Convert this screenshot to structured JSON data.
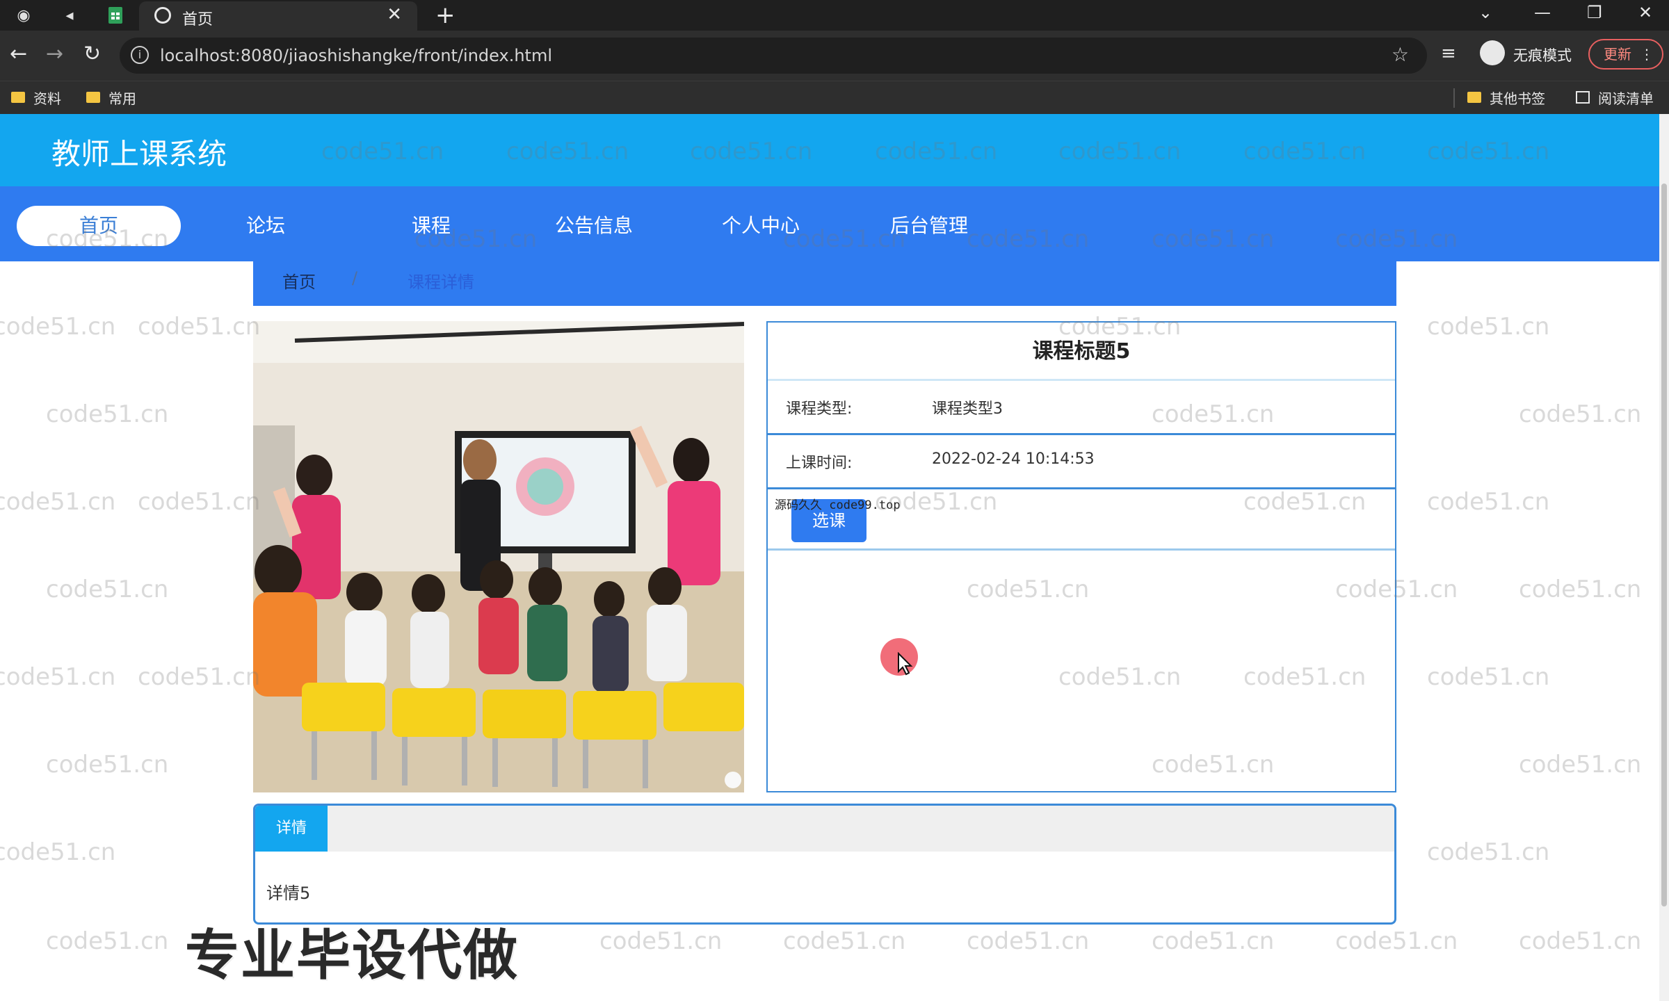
{
  "browser": {
    "tab_title": "首页",
    "url": "localhost:8080/jiaoshishangke/front/index.html",
    "incognito_label": "无痕模式",
    "update_label": "更新",
    "bookmarks": [
      {
        "label": "资料"
      },
      {
        "label": "常用"
      }
    ],
    "other_bookmarks": "其他书签",
    "reading_list": "阅读清单"
  },
  "site": {
    "title": "教师上课系统",
    "nav": [
      "首页",
      "论坛",
      "课程",
      "公告信息",
      "个人中心",
      "后台管理"
    ],
    "active_nav": "首页"
  },
  "breadcrumb": {
    "home": "首页",
    "separator": "/",
    "current": "课程详情"
  },
  "course": {
    "title": "课程标题5",
    "type_label": "课程类型:",
    "type_value": "课程类型3",
    "time_label": "上课时间:",
    "time_value": "2022-02-24 10:14:53",
    "select_button": "选课",
    "source_note": "源码久久 code99.top"
  },
  "detail": {
    "tab": "详情",
    "content": "详情5"
  },
  "overlay": {
    "promo": "专业毕设代做",
    "watermark": "code51.cn"
  }
}
